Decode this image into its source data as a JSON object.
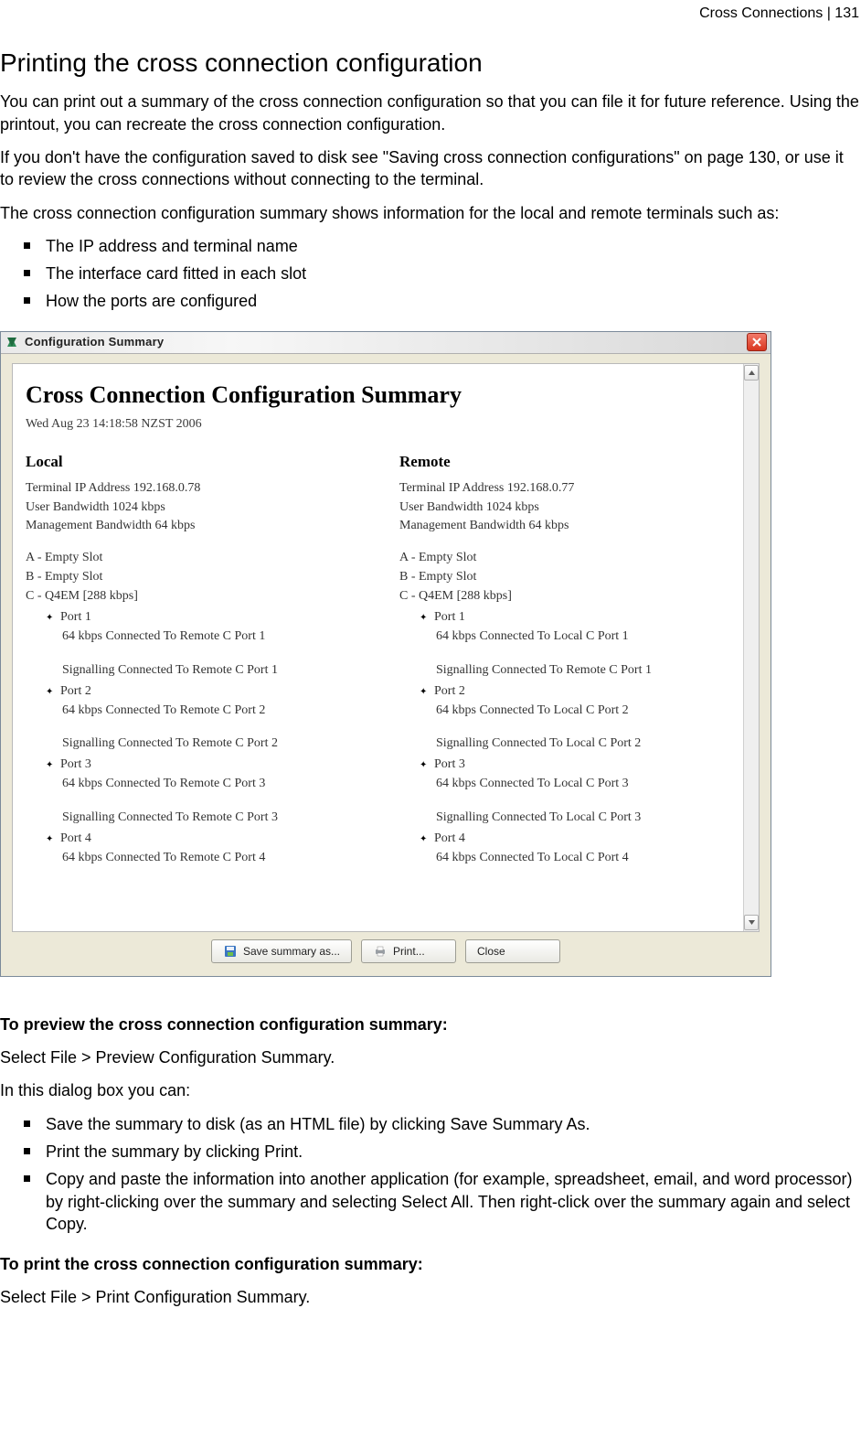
{
  "page_header": "Cross Connections  |  131",
  "section_title": "Printing the cross connection configuration",
  "intro1": "You can print out a summary of the cross connection configuration so that you can file it for future reference. Using the printout, you can recreate the cross connection configuration.",
  "intro2": "If you don't have the configuration saved to disk see \"Saving cross connection configurations\" on page 130, or use it to review the cross connections without connecting to the terminal.",
  "intro3": "The cross connection configuration summary shows information for the local and remote terminals such as:",
  "info_bullets": [
    "The IP address and terminal name",
    "The interface card fitted in each slot",
    "How the ports are configured"
  ],
  "window": {
    "title": "Configuration Summary",
    "buttons": {
      "save": "Save summary as...",
      "print": "Print...",
      "close": "Close"
    },
    "doc_title": "Cross Connection Configuration Summary",
    "doc_date": "Wed Aug 23 14:18:58 NZST 2006",
    "local": {
      "title": "Local",
      "ip": "Terminal IP Address 192.168.0.78",
      "user_bw": "User Bandwidth 1024 kbps",
      "mgmt_bw": "Management Bandwidth 64 kbps",
      "slots": [
        "A - Empty Slot",
        "B - Empty Slot",
        "C - Q4EM [288 kbps]"
      ],
      "ports": [
        {
          "title": "Port 1",
          "line1": "64 kbps Connected To Remote C Port 1",
          "line2": "Signalling Connected To Remote C Port 1"
        },
        {
          "title": "Port 2",
          "line1": "64 kbps Connected To Remote C Port 2",
          "line2": "Signalling Connected To Remote C Port 2"
        },
        {
          "title": "Port 3",
          "line1": "64 kbps Connected To Remote C Port 3",
          "line2": "Signalling Connected To Remote C Port 3"
        },
        {
          "title": "Port 4",
          "line1": "64 kbps Connected To Remote C Port 4"
        }
      ]
    },
    "remote": {
      "title": "Remote",
      "ip": "Terminal IP Address 192.168.0.77",
      "user_bandwidth": "User Bandwidth 1024 kbps",
      "mgmt_bw": "Management Bandwidth 64 kbps",
      "slots": [
        "A - Empty Slot",
        "B - Empty Slot",
        "C - Q4EM [288 kbps]"
      ],
      "ports": [
        {
          "title": "Port 1",
          "line1": "64 kbps Connected To Local C Port 1",
          "line2": "Signalling Connected To Remote C Port 1"
        },
        {
          "title": "Port 2",
          "line1": "64 kbps Connected To Local C Port 2",
          "line2": "Signalling Connected To Local C Port 2"
        },
        {
          "title": "Port 3",
          "line1": "64 kbps Connected To Local C Port 3",
          "line2": "Signalling Connected To Local C Port 3"
        },
        {
          "title": "Port 4",
          "line1": "64 kbps Connected To Local C Port 4"
        }
      ]
    }
  },
  "preview_heading": "To preview the cross connection configuration summary:",
  "preview_step": "Select File > Preview Configuration Summary.",
  "preview_intro": "In this dialog box you can:",
  "preview_bullets": [
    "Save the summary to disk (as an HTML file) by clicking Save Summary As.",
    "Print the summary by clicking Print.",
    "Copy and paste the information into another application (for example, spreadsheet, email, and word processor) by right-clicking over the summary and selecting Select All. Then right-click over the summary again and select Copy."
  ],
  "print_heading": "To print the cross connection configuration summary:",
  "print_step": "Select File > Print Configuration Summary."
}
